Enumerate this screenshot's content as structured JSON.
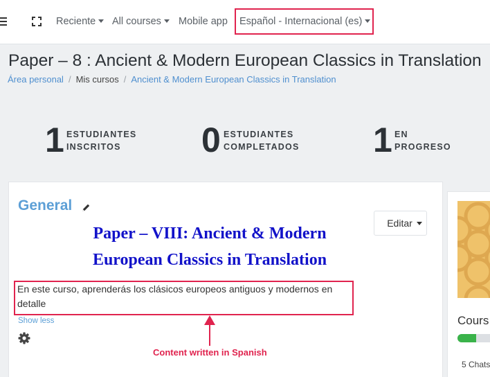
{
  "navbar": {
    "recent": "Reciente",
    "courses": "All courses",
    "mobile": "Mobile app",
    "language": "Español - Internacional (es)"
  },
  "page": {
    "title": "Paper – 8 : Ancient & Modern European Classics in Translation"
  },
  "breadcrumb": {
    "home": "Área personal",
    "my_courses": "Mis cursos",
    "course": "Ancient & Modern European Classics in Translation"
  },
  "stats": [
    {
      "number": "1",
      "line1": "ESTUDIANTES",
      "line2": "INSCRITOS"
    },
    {
      "number": "0",
      "line1": "ESTUDIANTES",
      "line2": "COMPLETADOS"
    },
    {
      "number": "1",
      "line1": "EN",
      "line2": "PROGRESO"
    }
  ],
  "section": {
    "title": "General",
    "edit_label": "Editar",
    "heading_line1": "Paper – VIII: Ancient & Modern",
    "heading_line2": "European Classics in Translation",
    "summary": "En este curso, aprenderás los clásicos europeos antiguos y modernos en detalle",
    "show_less": "Show less"
  },
  "annotation": {
    "text": "Content written in Spanish",
    "color": "#e0234e"
  },
  "sidebar_card": {
    "title": "Cours",
    "chats": "5 Chats",
    "progress": 0.45
  },
  "colors": {
    "accent": "#5c9fd6",
    "highlight": "#e0234e",
    "heading": "#1212c9",
    "progress": "#3ab34a"
  }
}
